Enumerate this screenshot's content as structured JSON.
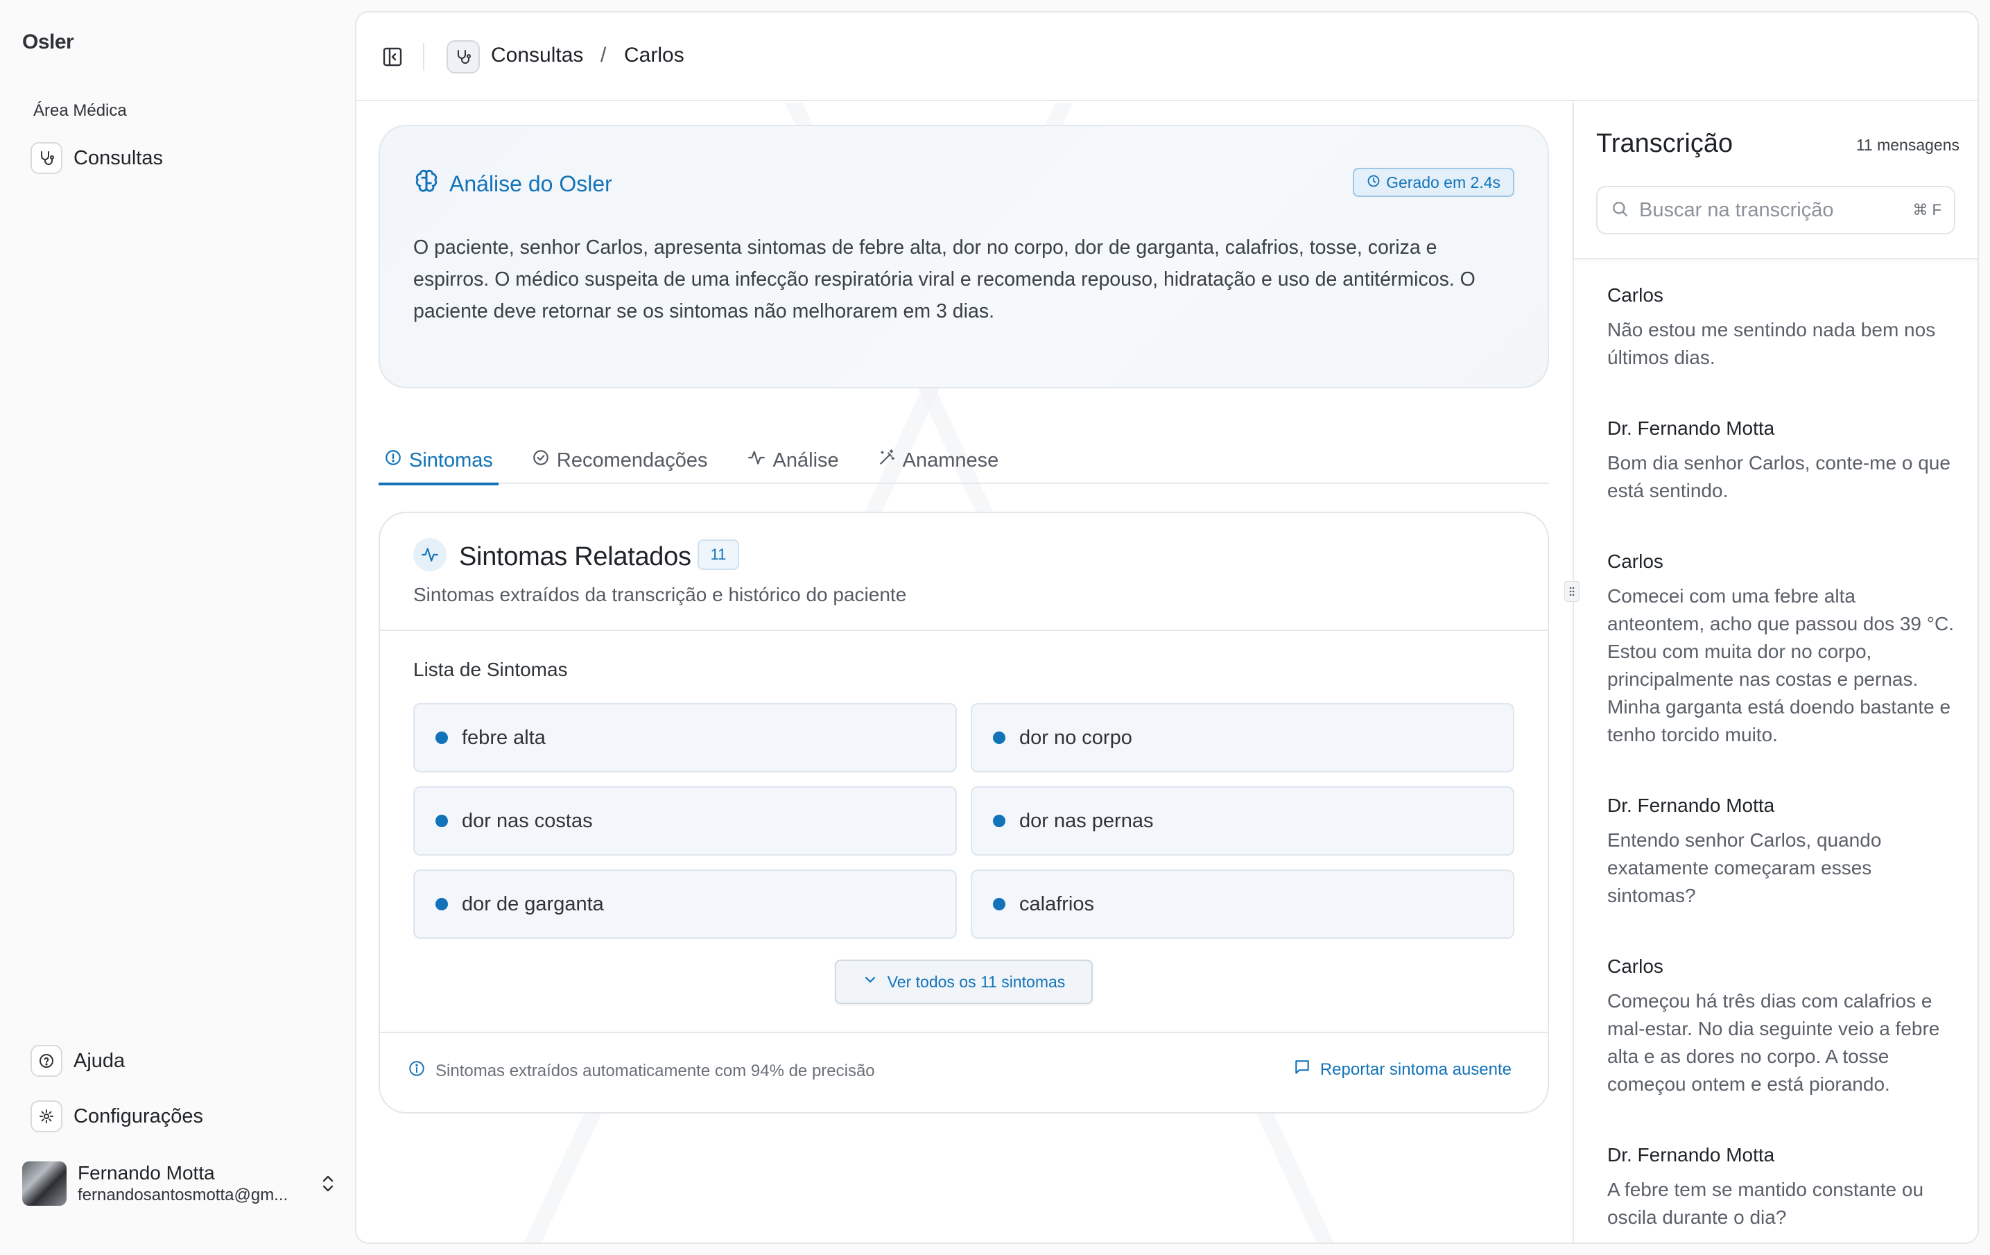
{
  "app": {
    "brand": "Osler",
    "colors": {
      "accent": "#1273b8",
      "background": "#fafafa"
    }
  },
  "sidebar": {
    "section_label": "Área Médica",
    "nav": [
      {
        "label": "Consultas",
        "icon": "stethoscope-icon"
      }
    ],
    "bottom": [
      {
        "label": "Ajuda",
        "icon": "help-circle-icon"
      },
      {
        "label": "Configurações",
        "icon": "gear-icon"
      }
    ],
    "user": {
      "name": "Fernando Motta",
      "email": "fernandosantosmotta@gm..."
    }
  },
  "breadcrumb": {
    "items": [
      "Consultas",
      "Carlos"
    ],
    "separator": "/"
  },
  "analysis": {
    "title": "Análise do Osler",
    "badge": "Gerado em 2.4s",
    "text": "O paciente, senhor Carlos, apresenta sintomas de febre alta, dor no corpo, dor de garganta, calafrios, tosse, coriza e espirros. O médico suspeita de uma infecção respiratória viral e recomenda repouso, hidratação e uso de antitérmicos. O paciente deve retornar se os sintomas não melhorarem em 3 dias."
  },
  "tabs": [
    {
      "label": "Sintomas",
      "icon": "alert-circle-icon",
      "active": true
    },
    {
      "label": "Recomendações",
      "icon": "check-circle-icon",
      "active": false
    },
    {
      "label": "Análise",
      "icon": "activity-icon",
      "active": false
    },
    {
      "label": "Anamnese",
      "icon": "magic-wand-icon",
      "active": false
    }
  ],
  "symptoms": {
    "title": "Sintomas Relatados",
    "count": "11",
    "subtitle": "Sintomas extraídos da transcrição e histórico do paciente",
    "list_label": "Lista de Sintomas",
    "items": [
      "febre alta",
      "dor no corpo",
      "dor nas costas",
      "dor nas pernas",
      "dor de garganta",
      "calafrios"
    ],
    "see_all": "Ver todos os 11 sintomas",
    "footer_note": "Sintomas extraídos automaticamente com 94% de precisão",
    "report_link": "Reportar sintoma ausente"
  },
  "transcript": {
    "title": "Transcrição",
    "count": "11 mensagens",
    "search_placeholder": "Buscar na transcrição",
    "shortcut": "⌘ F",
    "messages": [
      {
        "speaker": "Carlos",
        "text": "Não estou me sentindo nada bem nos últimos dias."
      },
      {
        "speaker": "Dr. Fernando Motta",
        "text": "Bom dia senhor Carlos, conte-me o que está sentindo."
      },
      {
        "speaker": "Carlos",
        "text": "Comecei com uma febre alta anteontem, acho que passou dos 39 °C. Estou com muita dor no corpo, principalmente nas costas e pernas. Minha garganta está doendo bastante e tenho torcido muito."
      },
      {
        "speaker": "Dr. Fernando Motta",
        "text": "Entendo senhor Carlos, quando exatamente começaram esses sintomas?"
      },
      {
        "speaker": "Carlos",
        "text": "Começou há três dias com calafrios e mal-estar. No dia seguinte veio a febre alta e as dores no corpo. A tosse começou ontem e está piorando."
      },
      {
        "speaker": "Dr. Fernando Motta",
        "text": "A febre tem se mantido constante ou oscila durante o dia?"
      }
    ]
  }
}
